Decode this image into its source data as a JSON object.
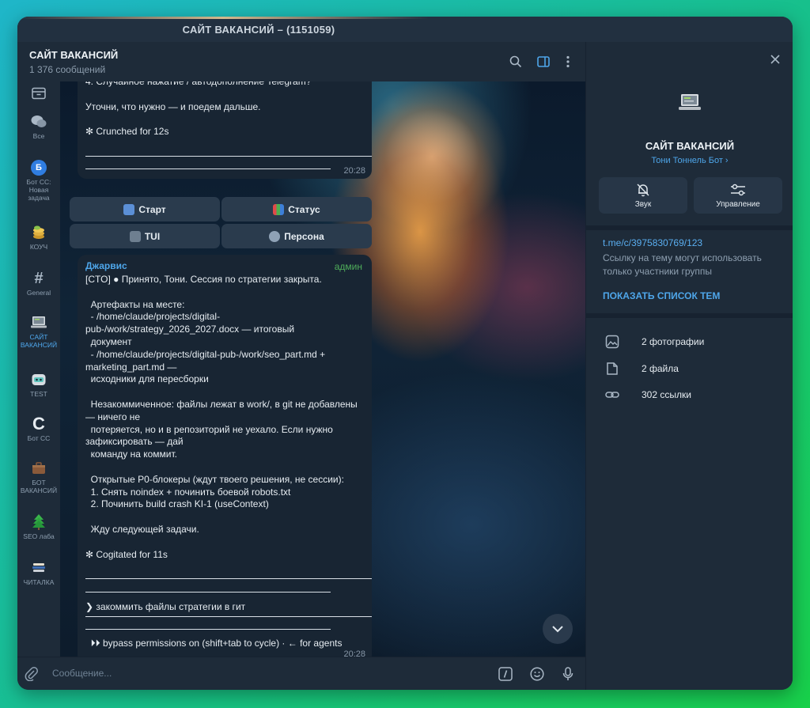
{
  "window": {
    "title": "САЙТ ВАКАНСИЙ – (1151059)"
  },
  "chat_header": {
    "title": "САЙТ ВАКАНСИЙ",
    "subtitle": "1 376 сообщений"
  },
  "sidebar": {
    "items": [
      {
        "label": "",
        "icon": "archive-icon"
      },
      {
        "label": "Все",
        "icon": "chats-icon"
      },
      {
        "label": "Бот CC: Новая задача",
        "icon_text": "Б",
        "icon": "bot-avatar-icon"
      },
      {
        "label": "КОУЧ",
        "icon": "coins-icon"
      },
      {
        "label": "General",
        "icon_text": "#",
        "icon": "hash-icon"
      },
      {
        "label": "САЙТ ВАКАНСИЙ",
        "icon": "laptop-icon"
      },
      {
        "label": "TEST",
        "icon": "robot-icon"
      },
      {
        "label": "Бот CC",
        "icon_text": "C",
        "icon": "c-logo-icon"
      },
      {
        "label": "БОТ ВАКАНСИЙ",
        "icon": "briefcase-icon"
      },
      {
        "label": "SEO лаба",
        "icon": "tree-icon"
      },
      {
        "label": "ЧИТАЛКА",
        "icon": "books-icon"
      }
    ]
  },
  "message1": {
    "lines": [
      "4. Случайное нажатие / автодополнение Telegram?",
      "",
      "Уточни, что нужно — и поедем дальше.",
      "",
      "✻ Crunched for 12s"
    ],
    "time": "20:28"
  },
  "keyboard1": {
    "start": "Старт",
    "status": "Статус",
    "tui": "TUI",
    "persona": "Персона"
  },
  "message2": {
    "sender": "Джарвис",
    "badge": "админ",
    "lines": [
      "[CTO] ● Принято, Тони. Сессия по стратегии закрыта.",
      "",
      "  Артефакты на месте:",
      "  - /home/claude/projects/digital-",
      "pub-/work/strategy_2026_2027.docx — итоговый",
      "  документ",
      "  - /home/claude/projects/digital-pub-/work/seo_part.md +",
      "marketing_part.md —",
      "  исходники для пересборки",
      "",
      "  Незакоммиченное: файлы лежат в work/, в git не добавлены",
      "— ничего не",
      "  потеряется, но и в репозиторий не уехало. Если нужно",
      "зафиксировать — дай",
      "  команду на коммит.",
      "",
      "  Открытые P0-блокеры (ждут твоего решения, не сессии):",
      "  1. Снять noindex + починить боевой robots.txt",
      "  2. Починить build crash KI-1 (useContext)",
      "",
      "  Жду следующей задачи.",
      "",
      "✻ Cogitated for 11s"
    ],
    "prompt": "❯ закоммить файлы стратегии в гит",
    "footer": "  ⏵⏵ bypass permissions on (shift+tab to cycle) · ← for agents",
    "time": "20:28"
  },
  "composer": {
    "placeholder": "Сообщение..."
  },
  "right_panel": {
    "title": "САЙТ ВАКАНСИЙ",
    "subtitle": "Тони Тоннель Бот ›",
    "buttons": {
      "sound": "Звук",
      "manage": "Управление"
    },
    "link": "t.me/c/3975830769/123",
    "link_desc": "Ссылку на тему могут использовать только участники группы",
    "show_topics": "ПОКАЗАТЬ СПИСОК ТЕМ",
    "media": [
      {
        "label": "2 фотографии",
        "icon": "photo-icon"
      },
      {
        "label": "2 файла",
        "icon": "file-icon"
      },
      {
        "label": "302 ссылки",
        "icon": "link-icon"
      }
    ]
  },
  "colors": {
    "accent": "#4ea6ea",
    "admin": "#4fae5a",
    "bubble": "#182533",
    "panel": "#1e2b39"
  }
}
